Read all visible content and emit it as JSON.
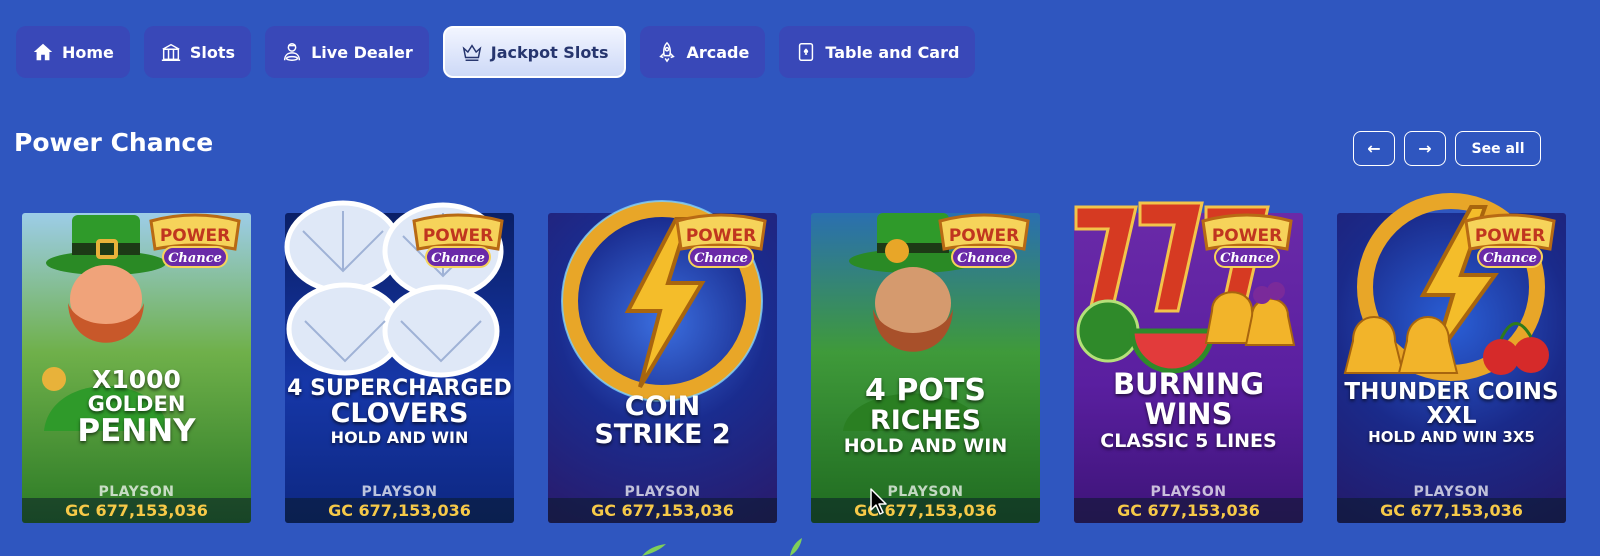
{
  "tabs": [
    {
      "label": "Home",
      "icon": "home-icon",
      "active": false
    },
    {
      "label": "Slots",
      "icon": "slot-machine-icon",
      "active": false
    },
    {
      "label": "Live Dealer",
      "icon": "dealer-icon",
      "active": false
    },
    {
      "label": "Jackpot Slots",
      "icon": "crown-icon",
      "active": true
    },
    {
      "label": "Arcade",
      "icon": "rocket-icon",
      "active": false
    },
    {
      "label": "Table and Card",
      "icon": "card-icon",
      "active": false
    }
  ],
  "section": {
    "title": "Power Chance",
    "prev_label": "←",
    "next_label": "→",
    "see_all_label": "See all"
  },
  "badge": {
    "line1": "POWER",
    "line2": "Chance"
  },
  "games": [
    {
      "title_lines": [
        "X1000",
        "GOLDEN",
        "PENNY"
      ],
      "subtitle": "",
      "provider": "PLAYSON",
      "jackpot": "GC 677,153,036"
    },
    {
      "title_lines": [
        "4 SUPERCHARGED",
        "CLOVERS"
      ],
      "subtitle": "HOLD AND WIN",
      "provider": "PLAYSON",
      "jackpot": "GC 677,153,036"
    },
    {
      "title_lines": [
        "COIN",
        "STRIKE 2"
      ],
      "subtitle": "",
      "provider": "PLAYSON",
      "jackpot": "GC 677,153,036"
    },
    {
      "title_lines": [
        "4 POTS",
        "RICHES"
      ],
      "subtitle": "HOLD AND WIN",
      "provider": "PLAYSON",
      "jackpot": "GC 677,153,036"
    },
    {
      "title_lines": [
        "BURNING",
        "WINS"
      ],
      "subtitle": "CLASSIC 5 LINES",
      "provider": "PLAYSON",
      "jackpot": "GC 677,153,036"
    },
    {
      "title_lines": [
        "THUNDER COINS",
        "XXL"
      ],
      "subtitle": "HOLD AND WIN 3X5",
      "provider": "PLAYSON",
      "jackpot": "GC 677,153,036"
    }
  ],
  "colors": {
    "background": "#2f56bf",
    "tab": "#3948b8",
    "jackpot_text": "#f6c948"
  }
}
